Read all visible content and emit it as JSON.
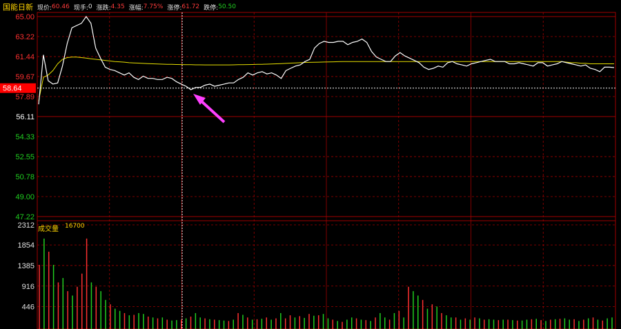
{
  "header": {
    "stock_name": "国能日新",
    "price_label": "现价:",
    "price_value": "60.46",
    "hand_label": "现手:",
    "hand_value": "0",
    "change_label": "涨跌:",
    "change_value": "4.35",
    "pct_label": "涨幅:",
    "pct_value": "7.75%",
    "limit_up_label": "涨停:",
    "limit_up_value": "61.72",
    "limit_down_label": "跌停:",
    "limit_down_value": "50.50"
  },
  "price_axis": {
    "ticks": [
      "65.00",
      "63.22",
      "61.44",
      "59.67",
      "57.89",
      "56.11",
      "54.33",
      "52.55",
      "50.78",
      "49.00",
      "47.22"
    ],
    "current_marker": "58.64"
  },
  "volume_panel": {
    "title": "成交量",
    "max_label": "16700",
    "ticks": [
      "2312",
      "1854",
      "1385",
      "916",
      "446"
    ]
  },
  "colors": {
    "grid": "#a00000",
    "price_line": "#ffffff",
    "avg_line": "#e8e000",
    "up": "#ff3030",
    "down": "#20d020",
    "arrow": "#ff40ff",
    "crosshair": "#ffffff",
    "marker_bg": "#ff0000"
  },
  "chart_data": {
    "type": "line",
    "y_range": [
      47.22,
      65.0
    ],
    "series": [
      {
        "name": "",
        "values": [
          57.2,
          61.6,
          59.3,
          59.0,
          59.1,
          60.6,
          62.6,
          64.0,
          64.2,
          64.4,
          65.0,
          64.4,
          62.2,
          61.3,
          60.5,
          60.3,
          60.2,
          60.0,
          59.8,
          60.0,
          59.6,
          59.4,
          59.7,
          59.5,
          59.5,
          59.4,
          59.4,
          59.6,
          59.5,
          59.2,
          59.0,
          58.8,
          58.5,
          58.7,
          58.7,
          58.9,
          59.0,
          58.8,
          58.9,
          59.0,
          59.1,
          59.1,
          59.4,
          59.6,
          60.0,
          59.8,
          60.0,
          60.1,
          59.9,
          60.0,
          59.8,
          59.5,
          60.2,
          60.4,
          60.6,
          60.7,
          61.0,
          61.2,
          62.2,
          62.6,
          62.8,
          62.7,
          62.7,
          62.8,
          62.8,
          62.5,
          62.7,
          62.8,
          63.0,
          62.7,
          61.9,
          61.4,
          61.2,
          61.0,
          61.0,
          61.5,
          61.8,
          61.5,
          61.3,
          61.1,
          60.9,
          60.5,
          60.3,
          60.4,
          60.6,
          60.5,
          60.9,
          61.0,
          60.8,
          60.7,
          60.6,
          60.8,
          60.9,
          61.0,
          61.1,
          61.2,
          61.0,
          61.0,
          61.0,
          60.8,
          60.8,
          60.9,
          60.8,
          60.7,
          60.6,
          60.9,
          60.9,
          60.6,
          60.7,
          60.8,
          61.0,
          60.9,
          60.8,
          60.7,
          60.6,
          60.7,
          60.4,
          60.3,
          60.1,
          60.5,
          60.5,
          60.46
        ]
      },
      {
        "name": "",
        "values": [
          57.5,
          59.6,
          59.8,
          60.2,
          60.8,
          61.2,
          61.35,
          61.4,
          61.4,
          61.35,
          61.3,
          61.25,
          61.2,
          61.15,
          61.1,
          61.05,
          61.0,
          60.98,
          60.95,
          60.9,
          60.88,
          60.86,
          60.84,
          60.82,
          60.8,
          60.78,
          60.77,
          60.76,
          60.75,
          60.74,
          60.73,
          60.72,
          60.72,
          60.71,
          60.71,
          60.7,
          60.7,
          60.7,
          60.7,
          60.7,
          60.7,
          60.71,
          60.72,
          60.72,
          60.73,
          60.74,
          60.75,
          60.76,
          60.77,
          60.78,
          60.8,
          60.82,
          60.84,
          60.86,
          60.88,
          60.9,
          60.92,
          60.93,
          60.94,
          60.95,
          60.96,
          60.97,
          60.98,
          60.99,
          61.0,
          61.0,
          61.0,
          61.0,
          61.0,
          61.0,
          61.0,
          61.0,
          61.0,
          61.0,
          61.0,
          61.0,
          61.0,
          61.0,
          61.0,
          61.0,
          61.0,
          61.0,
          61.0,
          61.0,
          61.0,
          61.0,
          61.0,
          61.0,
          61.0,
          61.0,
          61.0,
          61.0,
          61.0,
          61.0,
          61.0,
          61.0,
          61.0,
          61.0,
          61.0,
          61.0,
          61.0,
          61.0,
          61.0,
          61.0,
          61.0,
          61.0,
          61.0,
          61.0,
          61.0,
          61.0,
          61.0,
          60.95,
          60.9,
          60.9,
          60.85,
          60.85,
          60.8,
          60.8,
          60.8,
          60.8,
          60.8,
          60.8
        ]
      }
    ],
    "volume": {
      "y_range": [
        0,
        2312
      ],
      "values": [
        1400,
        2000,
        1700,
        1400,
        1000,
        1100,
        800,
        700,
        900,
        1200,
        2000,
        1000,
        900,
        800,
        600,
        500,
        400,
        350,
        300,
        250,
        260,
        300,
        280,
        220,
        200,
        180,
        200,
        150,
        130,
        140,
        150,
        180,
        220,
        300,
        200,
        180,
        160,
        150,
        140,
        130,
        120,
        150,
        300,
        260,
        200,
        150,
        160,
        170,
        200,
        150,
        180,
        300,
        180,
        250,
        200,
        230,
        190,
        280,
        240,
        250,
        280,
        180,
        150,
        120,
        100,
        150,
        200,
        180,
        150,
        140,
        120,
        200,
        300,
        200,
        150,
        300,
        350,
        200,
        900,
        800,
        700,
        600,
        400,
        500,
        450,
        300,
        250,
        200,
        200,
        150,
        180,
        150,
        200,
        180,
        150,
        160,
        150,
        140,
        150,
        150,
        140,
        130,
        130,
        150,
        160,
        170,
        140,
        120,
        150,
        160,
        170,
        180,
        150,
        160,
        120,
        150,
        180,
        200,
        150,
        130,
        180,
        200
      ],
      "directions": [
        "u",
        "d",
        "u",
        "d",
        "u",
        "d",
        "u",
        "d",
        "u",
        "u",
        "u",
        "d",
        "u",
        "d",
        "d",
        "u",
        "d",
        "d",
        "u",
        "d",
        "u",
        "d",
        "d",
        "u",
        "d",
        "u",
        "d",
        "u",
        "d",
        "d",
        "u",
        "d",
        "u",
        "d",
        "d",
        "u",
        "d",
        "u",
        "d",
        "d",
        "u",
        "d",
        "u",
        "d",
        "u",
        "d",
        "u",
        "d",
        "u",
        "d",
        "u",
        "d",
        "u",
        "u",
        "d",
        "u",
        "d",
        "u",
        "d",
        "u",
        "d",
        "d",
        "u",
        "d",
        "u",
        "d",
        "d",
        "u",
        "d",
        "u",
        "d",
        "u",
        "d",
        "d",
        "u",
        "d",
        "u",
        "d",
        "u",
        "d",
        "d",
        "u",
        "d",
        "u",
        "d",
        "u",
        "d",
        "d",
        "u",
        "d",
        "u",
        "d",
        "u",
        "d",
        "u",
        "d",
        "d",
        "u",
        "d",
        "u",
        "d",
        "u",
        "d",
        "d",
        "u",
        "d",
        "u",
        "d",
        "u",
        "d",
        "u",
        "d",
        "d",
        "u",
        "d",
        "u",
        "d",
        "u",
        "d",
        "u",
        "d",
        "d"
      ]
    }
  }
}
